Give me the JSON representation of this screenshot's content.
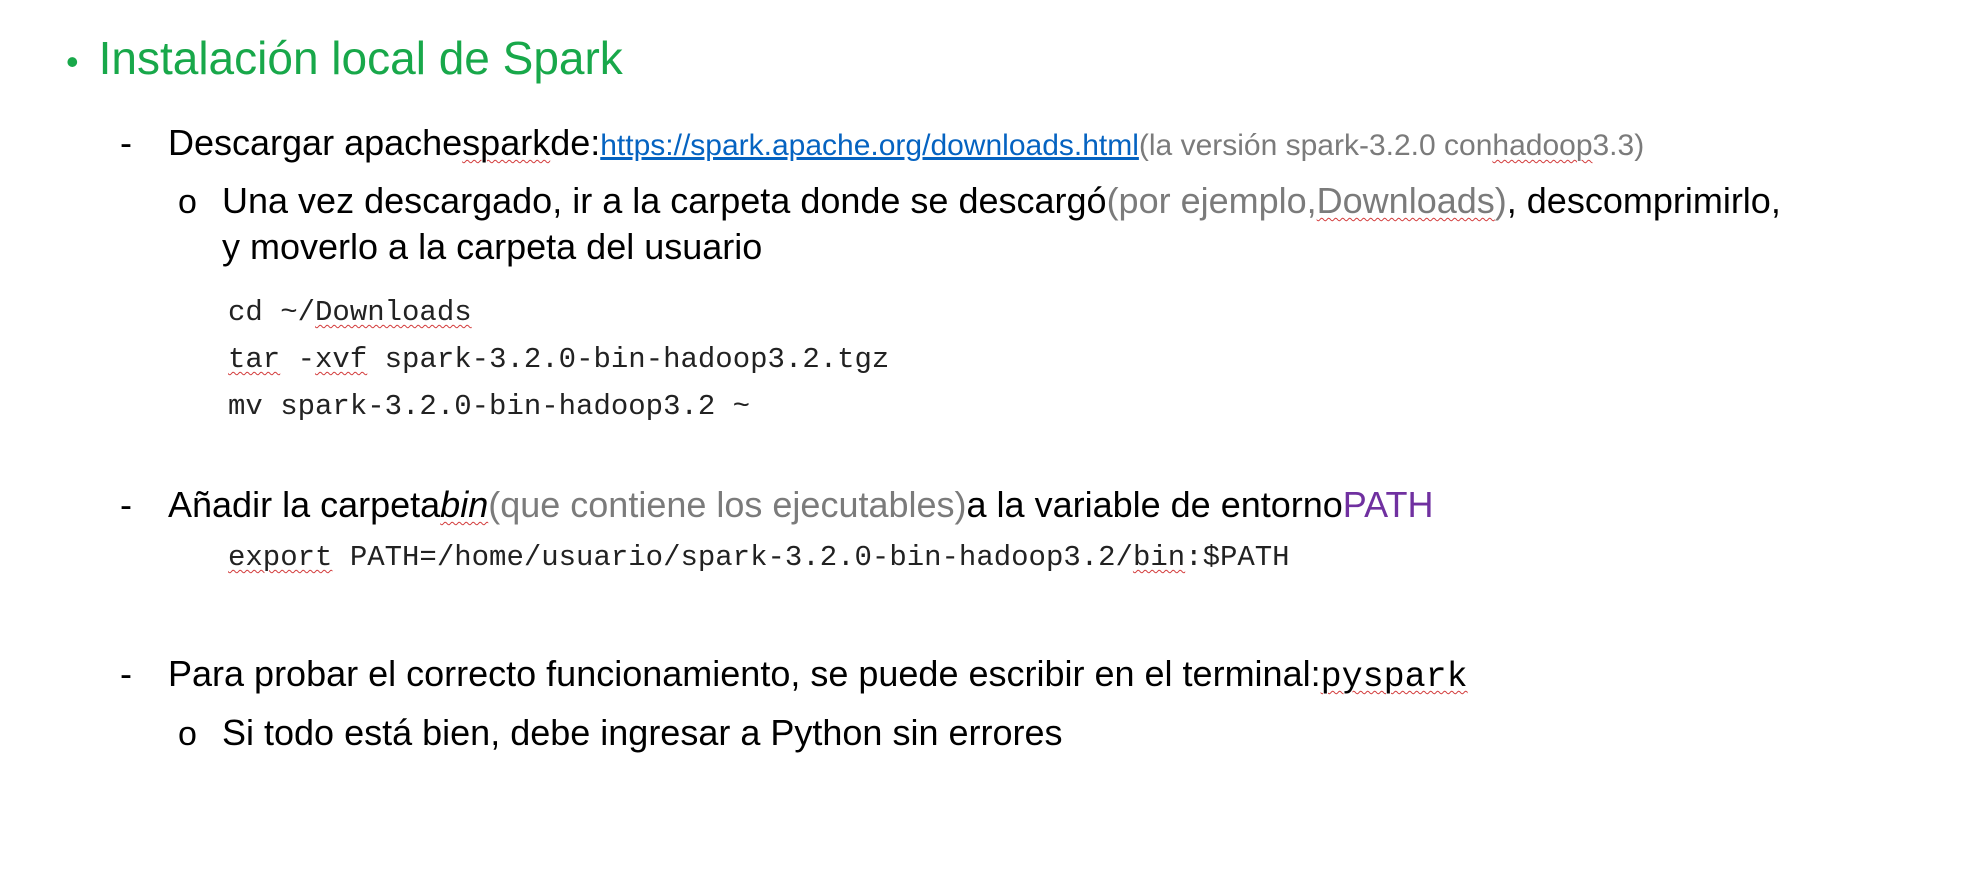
{
  "title": "Instalación local de Spark",
  "section1": {
    "text_a": "Descargar apache ",
    "text_spark": "spark",
    "text_b": " de: ",
    "link": "https://spark.apache.org/downloads.html",
    "note_a": " (la versión spark-3.2.0 con ",
    "note_hadoop": "hadoop",
    "note_b": " 3.3)",
    "sub": {
      "text_a": "Una vez descargado, ir a la carpeta donde se descargó ",
      "note_a": "(por ejemplo, ",
      "note_downloads": "Downloads",
      "note_b": ")",
      "text_b": ", descomprimirlo,",
      "text_line2": "y moverlo a la carpeta del usuario"
    },
    "code": {
      "l1_a": "cd ~/",
      "l1_b": "Downloads",
      "l2_a": "tar",
      "l2_b": " -",
      "l2_c": "xvf",
      "l2_d": " spark-3.2.0-bin-hadoop3.2.tgz",
      "l3": "mv spark-3.2.0-bin-hadoop3.2 ~"
    }
  },
  "section2": {
    "text_a": "Añadir la carpeta ",
    "bin": "bin",
    "note": " (que contiene los ejecutables)",
    "text_b": " a la variable de entorno ",
    "path": "PATH",
    "code": {
      "a": "export",
      "b": " PATH=/home/usuario/spark-3.2.0-bin-hadoop3.2/",
      "c": "bin",
      "d": ":$PATH"
    }
  },
  "section3": {
    "text": "Para probar el correcto funcionamiento, se puede escribir en el terminal: ",
    "cmd": "pyspark",
    "sub": "Si todo está bien, debe ingresar a Python sin errores"
  },
  "bullets": {
    "dot": "•",
    "dash": "-",
    "circle": "o"
  },
  "colors": {
    "title": "#18a84a",
    "muted": "#7b7b7b",
    "link": "#0563c1",
    "path": "#7030a0"
  }
}
